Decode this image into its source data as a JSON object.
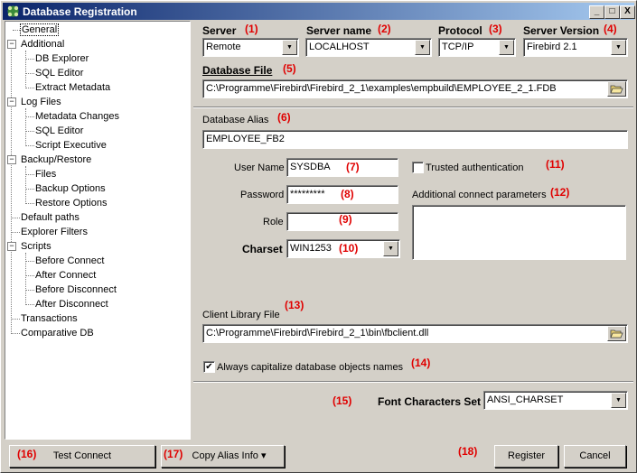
{
  "window": {
    "title": "Database Registration",
    "minimize": "_",
    "maximize": "□",
    "close": "X"
  },
  "tree": {
    "general": "General",
    "additional": "Additional",
    "db_explorer": "DB Explorer",
    "sql_editor": "SQL Editor",
    "extract_metadata": "Extract Metadata",
    "log_files": "Log Files",
    "metadata_changes": "Metadata Changes",
    "sql_editor_log": "SQL Editor",
    "script_executive": "Script Executive",
    "backup_restore": "Backup/Restore",
    "files": "Files",
    "backup_options": "Backup Options",
    "restore_options": "Restore Options",
    "default_paths": "Default paths",
    "explorer_filters": "Explorer Filters",
    "scripts": "Scripts",
    "before_connect": "Before Connect",
    "after_connect": "After Connect",
    "before_disconnect": "Before Disconnect",
    "after_disconnect": "After Disconnect",
    "transactions": "Transactions",
    "comparative_db": "Comparative DB",
    "expand_minus": "−"
  },
  "form": {
    "server_label": "Server",
    "server_value": "Remote",
    "server_name_label": "Server name",
    "server_name_value": "LOCALHOST",
    "protocol_label": "Protocol",
    "protocol_value": "TCP/IP",
    "server_version_label": "Server Version",
    "server_version_value": "Firebird 2.1",
    "database_file_label": "Database File",
    "database_file_value": "C:\\Programme\\Firebird\\Firebird_2_1\\examples\\empbuild\\EMPLOYEE_2_1.FDB",
    "database_alias_label": "Database Alias",
    "database_alias_value": "EMPLOYEE_FB2",
    "user_name_label": "User Name",
    "user_name_value": "SYSDBA",
    "password_label": "Password",
    "password_value": "*********",
    "role_label": "Role",
    "role_value": "",
    "charset_label": "Charset",
    "charset_value": "WIN1253",
    "trusted_auth_label": "Trusted authentication",
    "additional_params_label": "Additional connect parameters",
    "client_library_label": "Client Library File",
    "client_library_value": "C:\\Programme\\Firebird\\Firebird_2_1\\bin\\fbclient.dll",
    "capitalize_label": "Always capitalize database objects names",
    "capitalize_check": "✔",
    "font_charset_label": "Font Characters Set",
    "font_charset_value": "ANSI_CHARSET"
  },
  "markers": {
    "m1": "(1)",
    "m2": "(2)",
    "m3": "(3)",
    "m4": "(4)",
    "m5": "(5)",
    "m6": "(6)",
    "m7": "(7)",
    "m8": "(8)",
    "m9": "(9)",
    "m10": "(10)",
    "m11": "(11)",
    "m12": "(12)",
    "m13": "(13)",
    "m14": "(14)",
    "m15": "(15)",
    "m16": "(16)",
    "m17": "(17)",
    "m18": "(18)"
  },
  "buttons": {
    "test_connect": "Test Connect",
    "copy_alias_info": "Copy Alias Info ▾",
    "register": "Register",
    "cancel": "Cancel"
  },
  "colors": {
    "title_start": "#0a246a",
    "title_end": "#a6caf0",
    "marker": "#e00000",
    "face": "#d4d0c8"
  }
}
